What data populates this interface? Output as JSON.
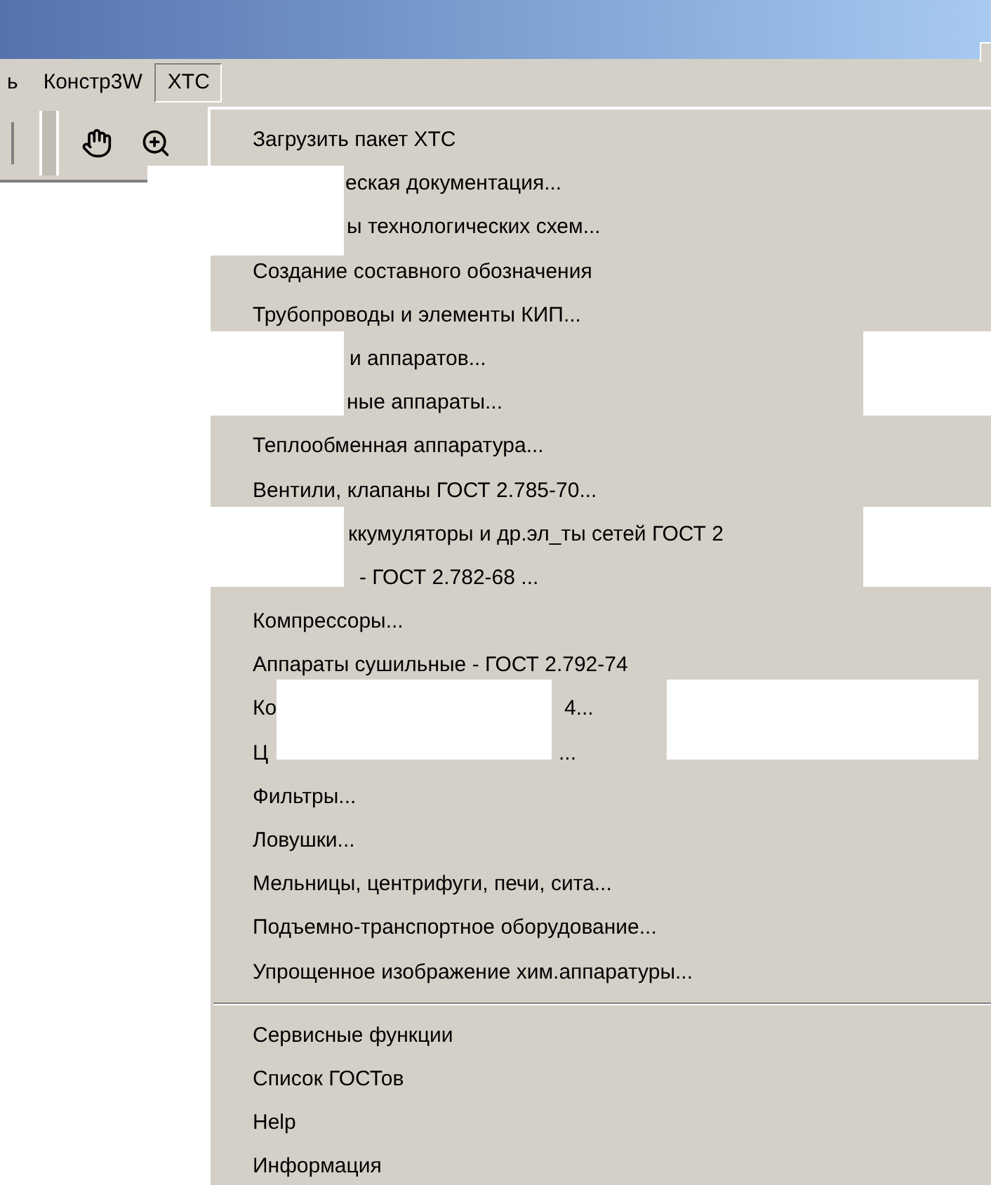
{
  "menu_bar": [
    {
      "label": "ь",
      "selected": false
    },
    {
      "label": "Констр3W",
      "selected": false
    },
    {
      "label": "ХТС",
      "selected": true
    }
  ],
  "dropdown": {
    "items": [
      {
        "kind": "item",
        "segments": [
          "Загрузить пакет ХТС"
        ]
      },
      {
        "kind": "item",
        "segments": [
          "еская документация..."
        ]
      },
      {
        "kind": "item",
        "segments": [
          "ы технологических схем..."
        ]
      },
      {
        "kind": "item",
        "segments": [
          "Создание составного обозначения"
        ]
      },
      {
        "kind": "item",
        "segments": [
          "Трубопроводы и элементы КИП..."
        ]
      },
      {
        "kind": "item",
        "segments": [
          "и аппаратов..."
        ]
      },
      {
        "kind": "item",
        "segments": [
          "ные аппараты..."
        ]
      },
      {
        "kind": "item",
        "segments": [
          "Теплообменная аппаратура..."
        ]
      },
      {
        "kind": "item",
        "segments": [
          "Вентили, клапаны  ГОСТ 2.785-70..."
        ]
      },
      {
        "kind": "item",
        "segments": [
          "ккумуляторы и др.эл_ты сетей ГОСТ 2"
        ]
      },
      {
        "kind": "item",
        "segments": [
          "- ГОСТ 2.782-68 ..."
        ]
      },
      {
        "kind": "item",
        "segments": [
          "Компрессоры..."
        ]
      },
      {
        "kind": "item",
        "segments": [
          "Аппараты сушильные - ГОСТ 2.792-74"
        ]
      },
      {
        "kind": "item",
        "segments": [
          "Ко",
          "4..."
        ]
      },
      {
        "kind": "item",
        "segments": [
          "Ц",
          "..."
        ]
      },
      {
        "kind": "item",
        "segments": [
          "Фильтры..."
        ]
      },
      {
        "kind": "item",
        "segments": [
          "Ловушки..."
        ]
      },
      {
        "kind": "item",
        "segments": [
          "Мельницы, центрифуги, печи, сита..."
        ]
      },
      {
        "kind": "item",
        "segments": [
          "Подъемно-транспортное оборудование..."
        ]
      },
      {
        "kind": "item",
        "segments": [
          "Упрощенное изображение хим.аппаратуры..."
        ]
      },
      {
        "kind": "separator"
      },
      {
        "kind": "item",
        "segments": [
          "Сервисные функции"
        ]
      },
      {
        "kind": "item",
        "segments": [
          "Список ГОСТов"
        ]
      },
      {
        "kind": "item",
        "segments": [
          "Help"
        ]
      },
      {
        "kind": "item",
        "segments": [
          "Информация"
        ]
      }
    ]
  }
}
